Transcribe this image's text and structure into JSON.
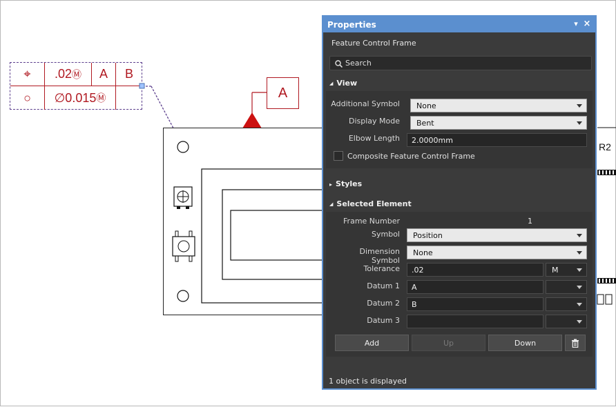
{
  "fcf": {
    "row1": {
      "symbol": "⌖",
      "tolerance": ".02",
      "tolerance_mod": "Ⓜ",
      "datum1": "A",
      "datum2": "B"
    },
    "row2": {
      "symbol": "○",
      "tolerance": "∅0.015",
      "tolerance_mod": "Ⓜ"
    }
  },
  "datum_feature": {
    "label": "A"
  },
  "background_text": {
    "r2": "R2"
  },
  "panel": {
    "title": "Properties",
    "collapse_glyph": "▾",
    "close_glyph": "×",
    "subtitle": "Feature Control Frame",
    "search_placeholder": "Search",
    "view": {
      "header": "View",
      "additional_symbol_label": "Additional Symbol",
      "additional_symbol_value": "None",
      "display_mode_label": "Display Mode",
      "display_mode_value": "Bent",
      "elbow_length_label": "Elbow Length",
      "elbow_length_value": "2.0000mm",
      "composite_label": "Composite Feature Control Frame"
    },
    "styles": {
      "header": "Styles"
    },
    "selected": {
      "header": "Selected Element",
      "frame_number_label": "Frame Number",
      "frame_number_value": "1",
      "symbol_label": "Symbol",
      "symbol_value": "Position",
      "dimension_symbol_label": "Dimension Symbol",
      "dimension_symbol_value": "None",
      "tolerance_label": "Tolerance",
      "tolerance_value": ".02",
      "tolerance_mod": "M",
      "datum1_label": "Datum 1",
      "datum1_value": "A",
      "datum2_label": "Datum 2",
      "datum2_value": "B",
      "datum3_label": "Datum 3",
      "datum3_value": ""
    },
    "buttons": {
      "add": "Add",
      "up": "Up",
      "down": "Down"
    },
    "status": "1 object is displayed"
  },
  "colors": {
    "accent": "#5b8fcf",
    "drawing_red": "#b01820",
    "leader_purple": "#5a3d8c"
  }
}
